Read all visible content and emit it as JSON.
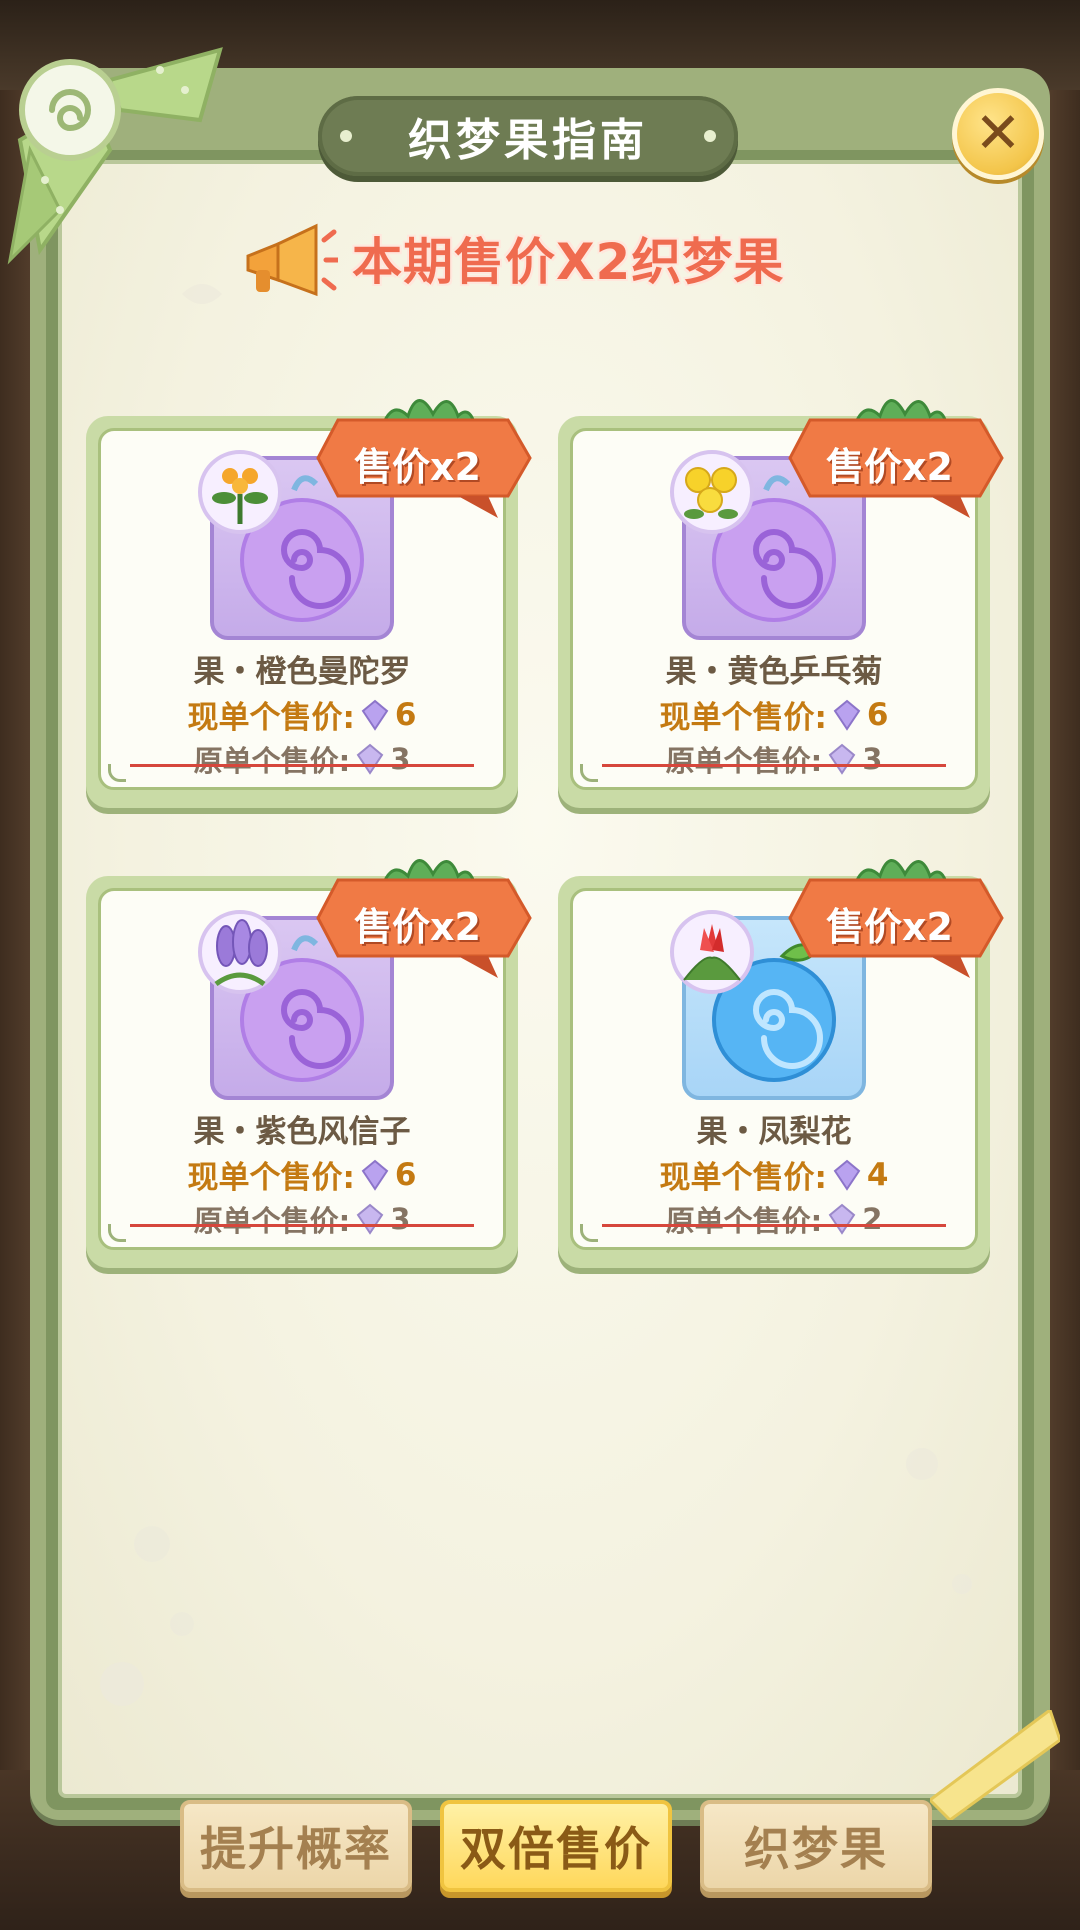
{
  "dialog": {
    "title": "织梦果指南",
    "announcement": "本期售价X2织梦果"
  },
  "cards": [
    {
      "ribbon": "售价x2",
      "name": "果・橙色曼陀罗",
      "price_now_label": "现单个售价:",
      "price_now_value": "6",
      "price_old_label": "原单个售价:",
      "price_old_value": "3",
      "fruit_color": "purple"
    },
    {
      "ribbon": "售价x2",
      "name": "果・黄色乒乓菊",
      "price_now_label": "现单个售价:",
      "price_now_value": "6",
      "price_old_label": "原单个售价:",
      "price_old_value": "3",
      "fruit_color": "purple"
    },
    {
      "ribbon": "售价x2",
      "name": "果・紫色风信子",
      "price_now_label": "现单个售价:",
      "price_now_value": "6",
      "price_old_label": "原单个售价:",
      "price_old_value": "3",
      "fruit_color": "purple"
    },
    {
      "ribbon": "售价x2",
      "name": "果・凤梨花",
      "price_now_label": "现单个售价:",
      "price_now_value": "4",
      "price_old_label": "原单个售价:",
      "price_old_value": "2",
      "fruit_color": "blue"
    }
  ],
  "tabs": [
    {
      "label": "提升概率",
      "active": false
    },
    {
      "label": "双倍售价",
      "active": true
    },
    {
      "label": "织梦果",
      "active": false
    }
  ],
  "icons": {
    "close": "close-icon",
    "megaphone": "megaphone-icon",
    "crystal": "crystal-currency-icon",
    "bow": "bow-icon"
  },
  "colors": {
    "frame": "#9fb07c",
    "title_pill": "#6e7c53",
    "announcement": "#ef6b4f",
    "price_now": "#c47a12",
    "strike": "#d6473c",
    "ribbon": "#f07a45"
  }
}
